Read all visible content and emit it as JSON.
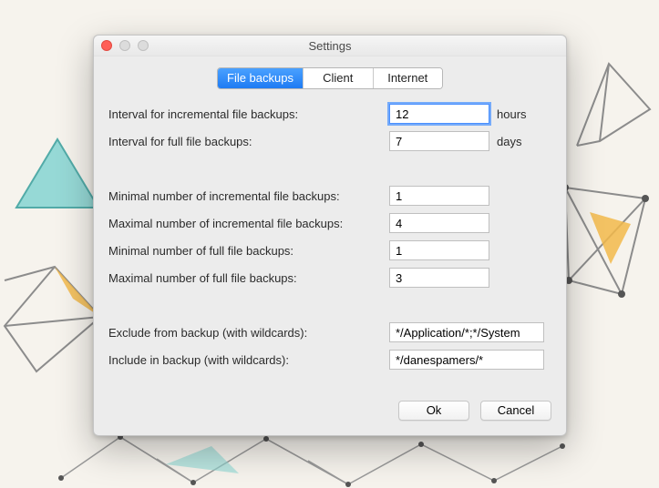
{
  "window": {
    "title": "Settings"
  },
  "tabs": {
    "file_backups": "File backups",
    "client": "Client",
    "internet": "Internet"
  },
  "fields": {
    "incr_interval": {
      "label": "Interval for incremental file backups:",
      "value": "12",
      "unit": "hours"
    },
    "full_interval": {
      "label": "Interval for full file backups:",
      "value": "7",
      "unit": "days"
    },
    "min_incr": {
      "label": "Minimal number of incremental file backups:",
      "value": "1"
    },
    "max_incr": {
      "label": "Maximal number of incremental file backups:",
      "value": "4"
    },
    "min_full": {
      "label": "Minimal number of full file backups:",
      "value": "1"
    },
    "max_full": {
      "label": "Maximal number of full file backups:",
      "value": "3"
    },
    "exclude": {
      "label": "Exclude from backup (with wildcards):",
      "value": "*/Application/*;*/System"
    },
    "include": {
      "label": "Include in backup (with wildcards):",
      "value": "*/danespamers/*"
    }
  },
  "buttons": {
    "ok": "Ok",
    "cancel": "Cancel"
  }
}
